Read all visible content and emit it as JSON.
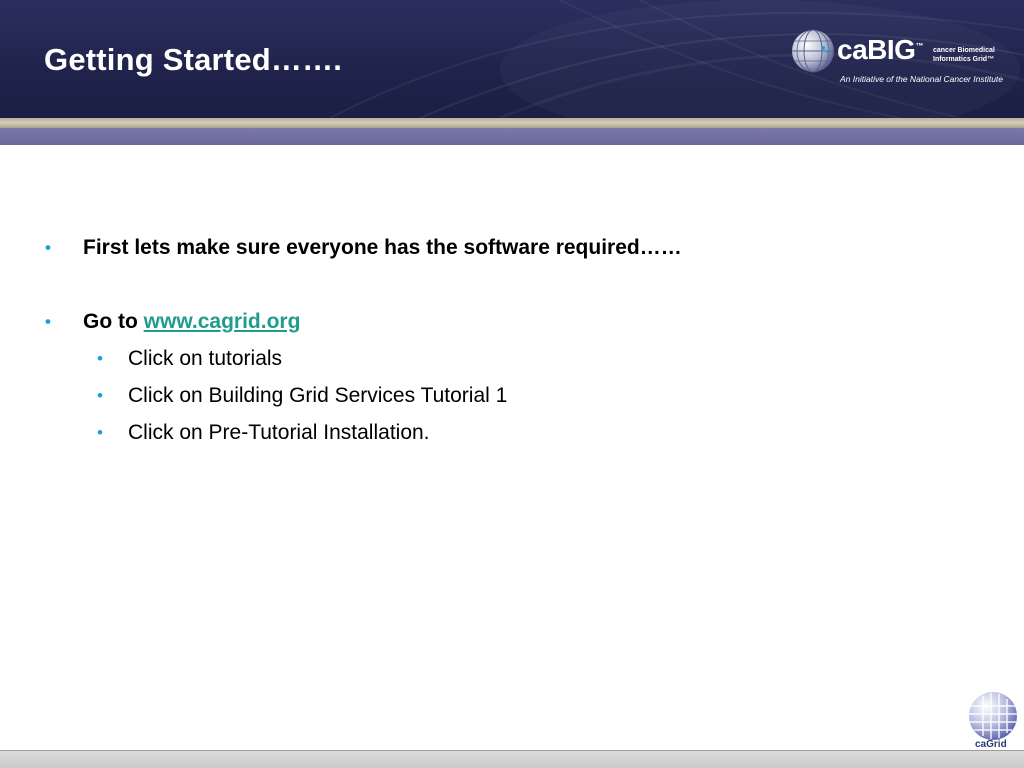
{
  "slide": {
    "title": "Getting Started…….",
    "logo": {
      "word": "caBIG",
      "trademark": "™",
      "sub_line1": "cancer Biomedical",
      "sub_line2": "Informatics Grid™",
      "tagline": "An Initiative of the National Cancer Institute",
      "icon": "globe-icon"
    },
    "bullets": [
      {
        "text": "First lets make sure everyone has the software required……"
      },
      {
        "prefix": "Go to ",
        "link": "www.cagrid.org"
      }
    ],
    "sub_bullets": [
      "Click on tutorials",
      "Click on Building Grid Services Tutorial 1",
      "Click on Pre-Tutorial Installation."
    ],
    "footer_logo": {
      "text": "caGrid",
      "icon": "grid-globe-icon"
    }
  },
  "colors": {
    "header": "#20244d",
    "bullet": "#1aa0d8",
    "link": "#1f9d8a",
    "stripe_tan": "#c6c0aa",
    "stripe_purple": "#6f6c9e"
  }
}
